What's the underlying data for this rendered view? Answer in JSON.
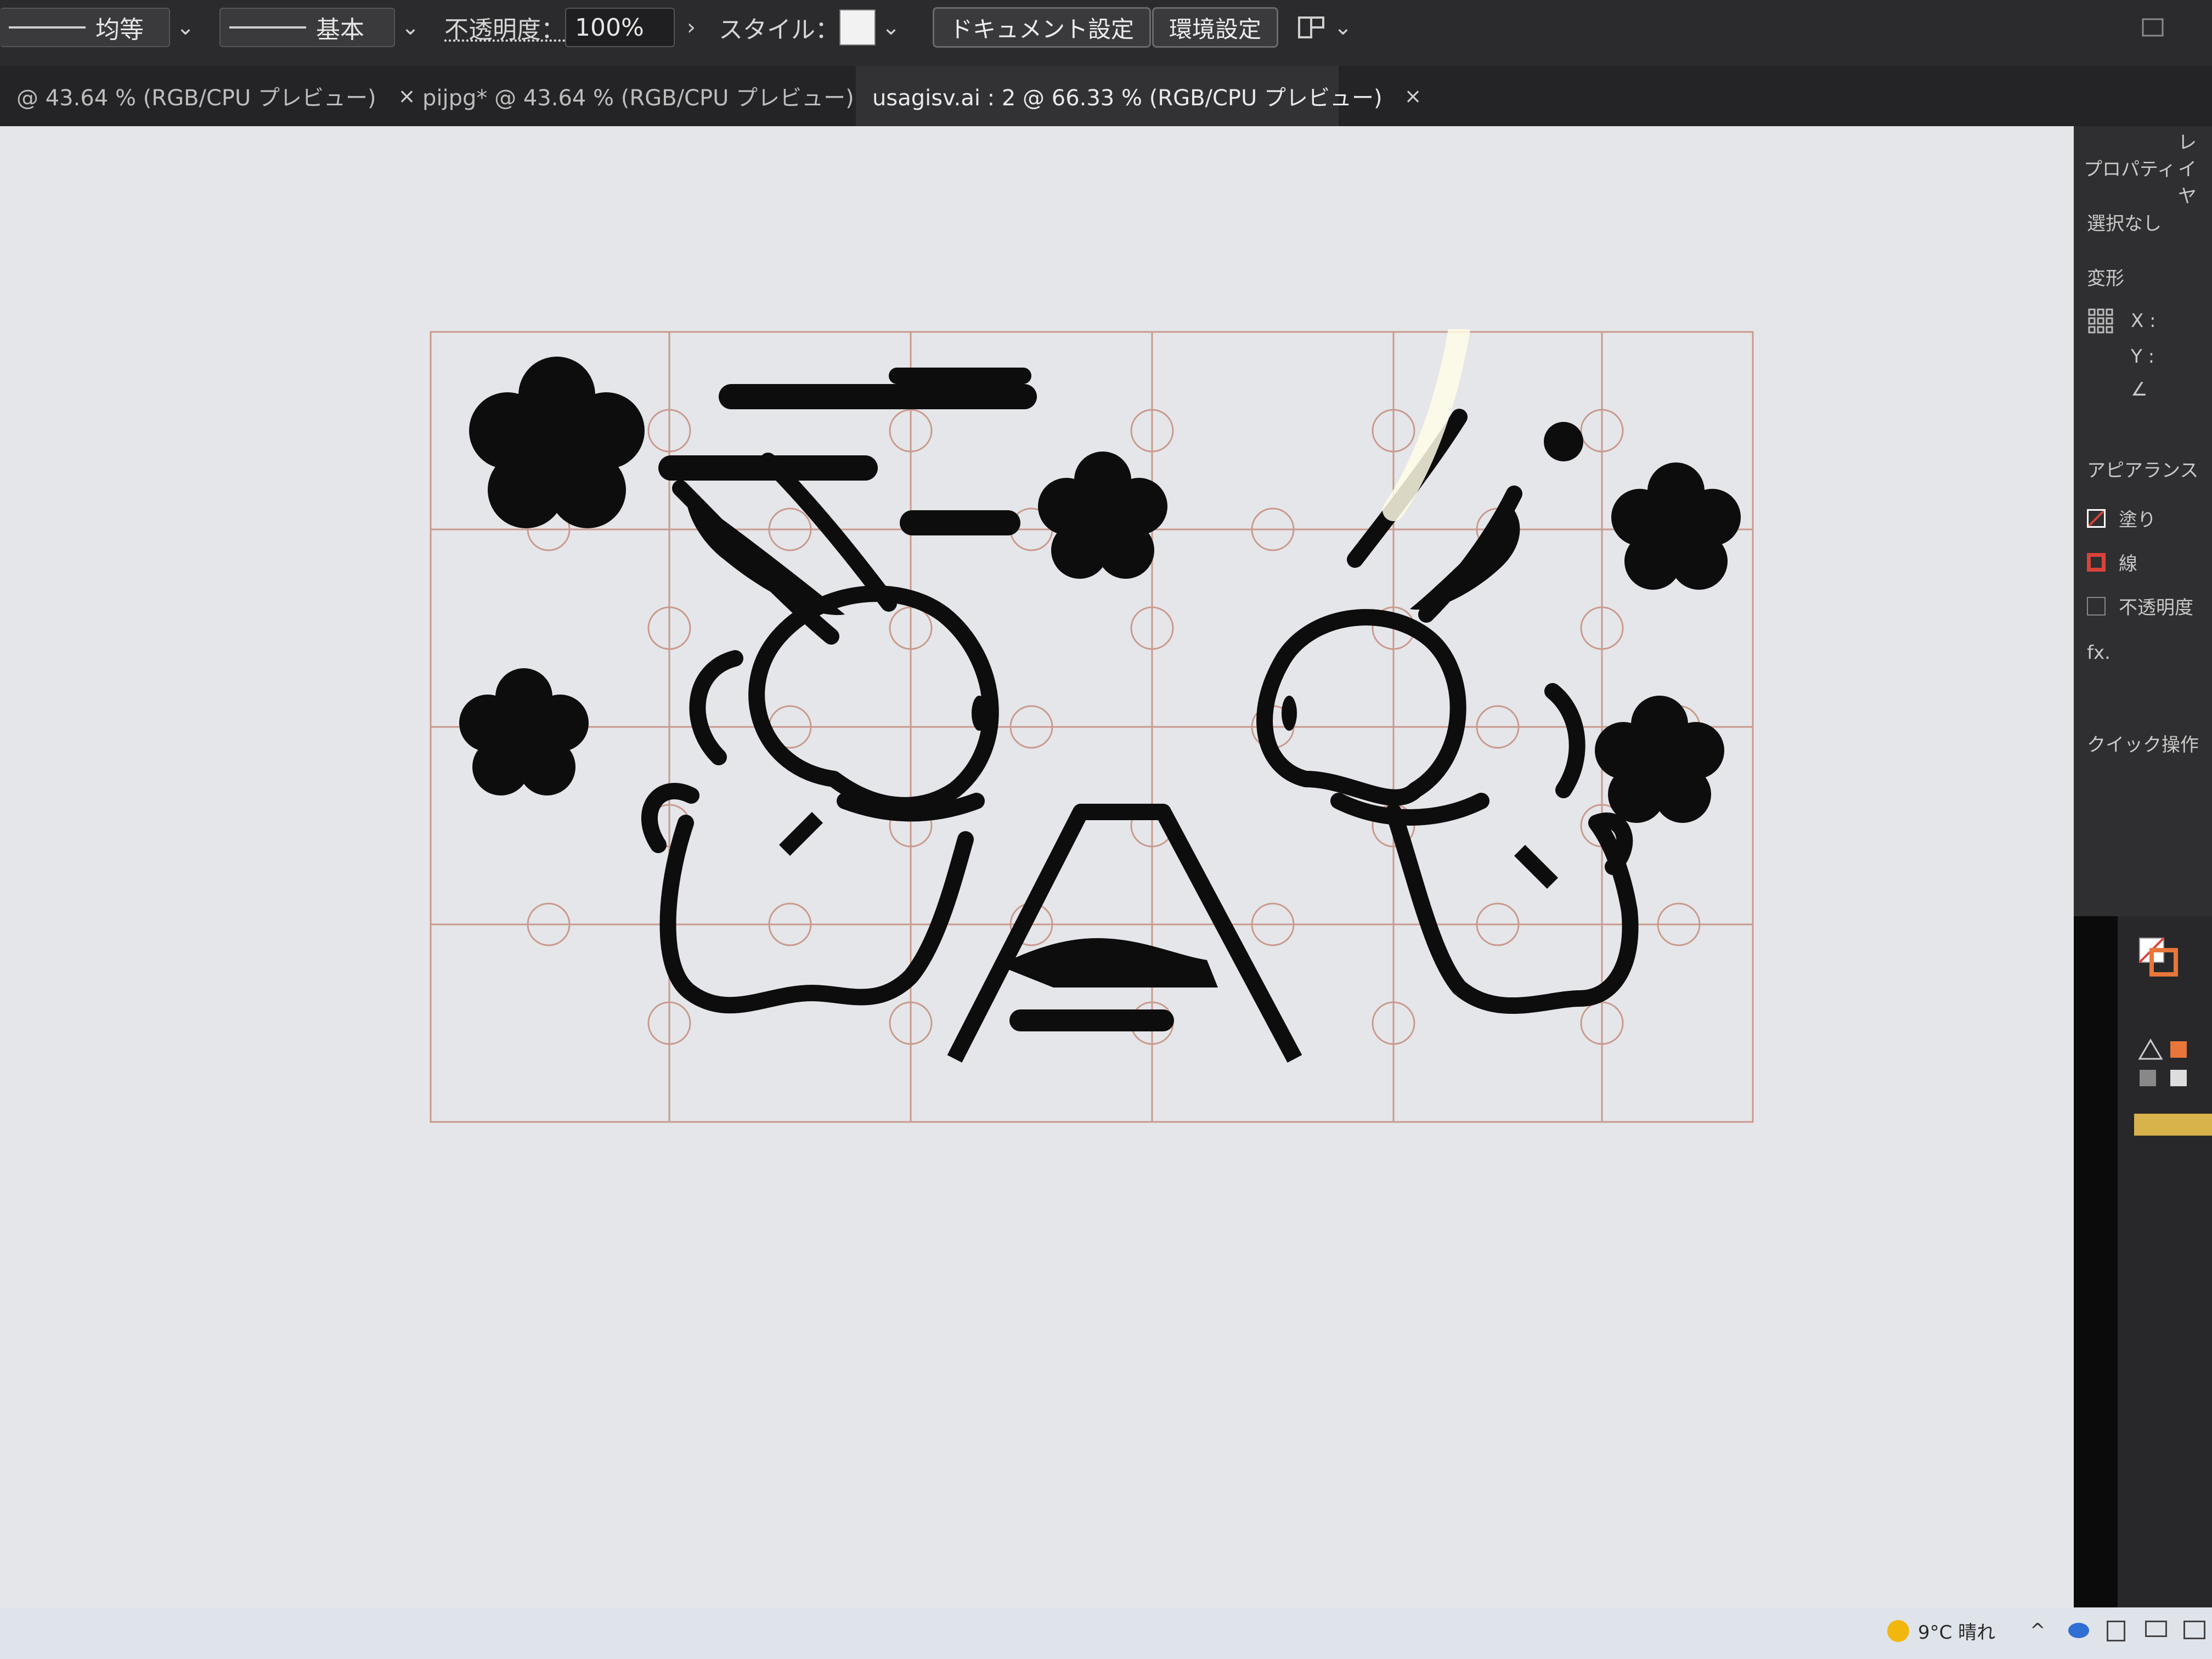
{
  "control_bar": {
    "profile_value": "均等",
    "brush_value": "基本",
    "opacity_label": "不透明度：",
    "opacity_value": "100%",
    "style_label": "スタイル：",
    "doc_settings_label": "ドキュメント設定",
    "prefs_label": "環境設定"
  },
  "tabs": [
    {
      "label": "@ 43.64 % (RGB/CPU プレビュー)"
    },
    {
      "label": "pijpg* @ 43.64 % (RGB/CPU プレビュー)"
    },
    {
      "label": "usagisv.ai : 2 @ 66.33 % (RGB/CPU プレビュー)"
    }
  ],
  "properties_panel": {
    "tab_properties": "プロパティ",
    "tab_layers": "レイヤ",
    "selection_status": "選択なし",
    "transform_heading": "変形",
    "x_label": "X :",
    "y_label": "Y :",
    "angle_label": "∠",
    "appearance_heading": "アピアランス",
    "fill_label": "塗り",
    "stroke_label": "線",
    "opacity_label": "不透明度",
    "fx_label": "fx.",
    "quick_actions_heading": "クイック操作"
  },
  "taskbar": {
    "weather": "9°C 晴れ"
  },
  "colors": {
    "accent_orange": "#e8763a",
    "stroke_red": "#d9433a",
    "artwork": "#0d0d0d",
    "cut_lines": "#c99a8e"
  }
}
